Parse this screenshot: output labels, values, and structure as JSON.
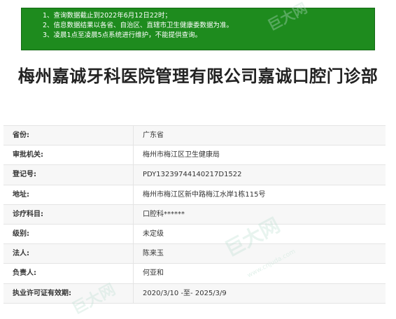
{
  "notice": {
    "lines": [
      "1、查询数据截止到2022年6月12日22时；",
      "2、信息数据结果以各省、自治区、直辖市卫生健康委数据为准。",
      "3、凌晨1点至凌晨5点系统进行维护，不能提供查询。"
    ]
  },
  "title": "梅州嘉诚牙科医院管理有限公司嘉诚口腔门诊部",
  "rows": [
    {
      "label": "省份:",
      "value": "广东省"
    },
    {
      "label": "审批机关:",
      "value": "梅州市梅江区卫生健康局"
    },
    {
      "label": "登记号:",
      "value": "PDY13239744140217D1522"
    },
    {
      "label": "地址:",
      "value": "梅州市梅江区新中路梅江水岸1栋115号"
    },
    {
      "label": "诊疗科目:",
      "value": "口腔科******"
    },
    {
      "label": "级别:",
      "value": "未定级"
    },
    {
      "label": "法人:",
      "value": "陈来玉"
    },
    {
      "label": "负责人:",
      "value": "何亚和"
    },
    {
      "label": "执业许可证有效期:",
      "value": "2020/3/10 -至- 2025/3/9"
    }
  ],
  "watermark": {
    "text": "巨大网",
    "url": "www.cnjuda.com"
  }
}
